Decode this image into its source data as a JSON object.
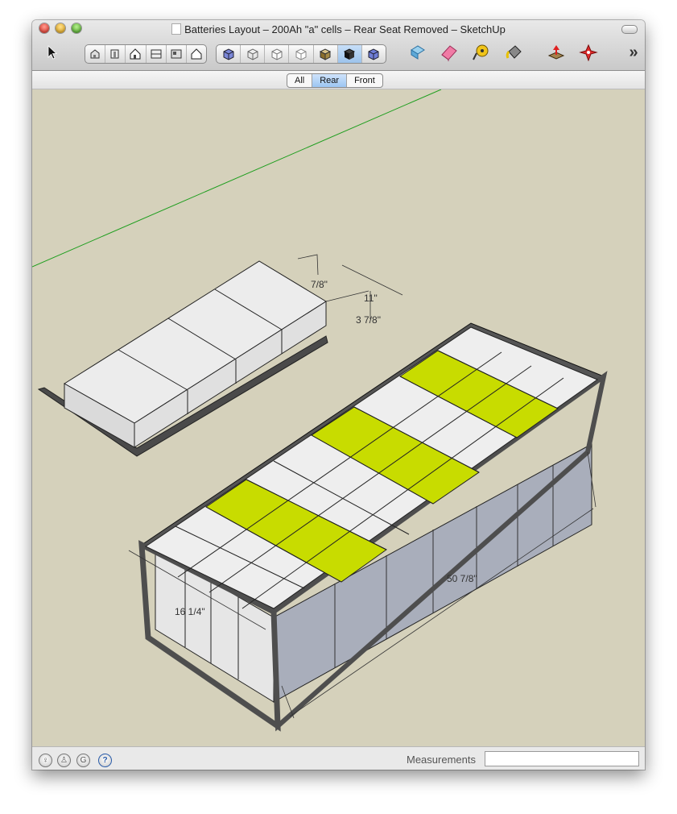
{
  "window": {
    "title": "Batteries Layout – 200Ah \"a\" cells – Rear Seat Removed – SketchUp"
  },
  "toolbar": {
    "select_tool": "arrow-select-icon",
    "views_group": [
      "iso-view-icon",
      "right-view-icon",
      "front-view-icon",
      "top-view-icon",
      "back-view-icon",
      "left-view-icon"
    ],
    "styles_group": [
      "xray-icon",
      "wireframe-icon",
      "hidden-line-icon",
      "shaded-icon",
      "shaded-textures-icon",
      "monochrome-icon",
      "back-edges-icon"
    ],
    "extra_tools": [
      "component-icon",
      "eraser-icon",
      "tape-measure-icon",
      "paint-bucket-icon",
      "push-pull-icon",
      "orbit-icon"
    ],
    "overflow_label": "»"
  },
  "scenes": {
    "tabs": [
      "All",
      "Rear",
      "Front"
    ],
    "selected": "Rear"
  },
  "dimensions": {
    "d1": "7/8\"",
    "d2": "11\"",
    "d3": "3 7/8\"",
    "d4": "16 1/4\"",
    "d5": "50 7/8\""
  },
  "status": {
    "measurements_label": "Measurements",
    "measurements_value": ""
  },
  "colors": {
    "viewport_bg": "#d5d1bb",
    "highlight_cell": "#c8dc00",
    "axis_green": "#1e9e1e"
  }
}
